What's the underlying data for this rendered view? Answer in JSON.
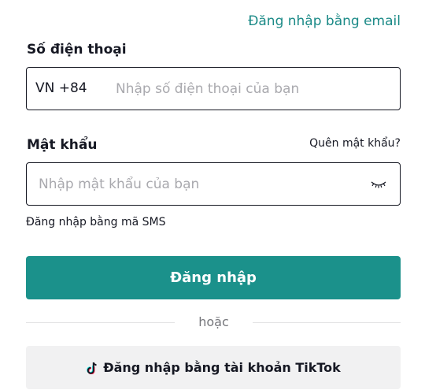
{
  "header": {
    "email_login_link": "Đăng nhập bằng email"
  },
  "phone": {
    "label": "Số điện thoại",
    "country_code": "VN +84",
    "placeholder": "Nhập số điện thoại của bạn",
    "value": ""
  },
  "password": {
    "label": "Mật khẩu",
    "forgot_link": "Quên mật khẩu?",
    "placeholder": "Nhập mật khẩu của bạn",
    "value": "",
    "visibility_icon": "eye-closed-icon"
  },
  "sms_login_link": "Đăng nhập bằng mã SMS",
  "login_button": {
    "label": "Đăng nhập"
  },
  "divider": {
    "text": "hoặc"
  },
  "tiktok_button": {
    "icon": "tiktok-logo-icon",
    "label": "Đăng nhập bằng tài khoản TikTok"
  },
  "colors": {
    "accent": "#1b918b",
    "link": "#1b8a87",
    "text": "#161823",
    "placeholder": "#a9a9ae",
    "secondary_button_bg": "#f1f1f2"
  }
}
